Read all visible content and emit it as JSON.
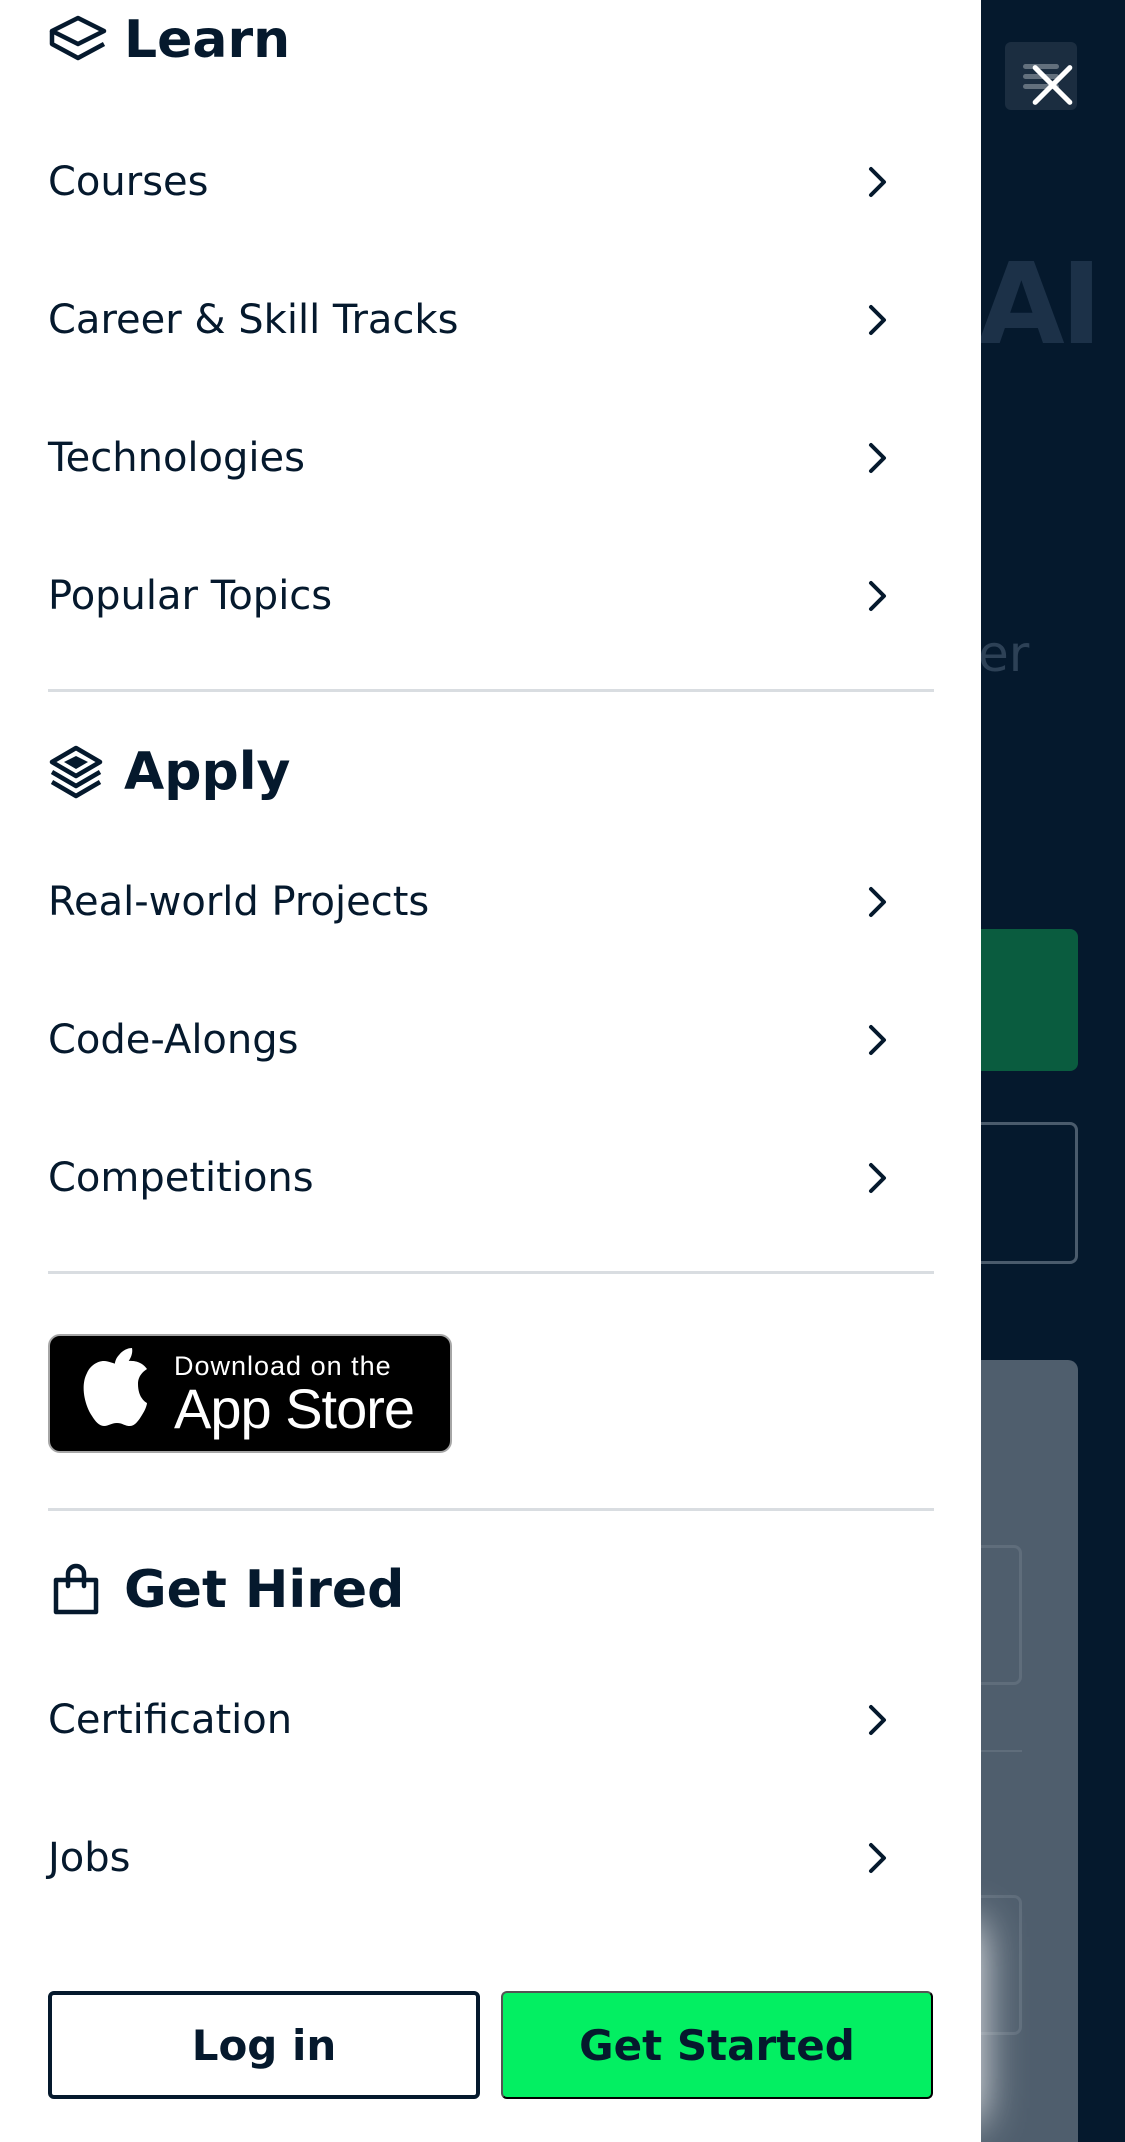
{
  "background": {
    "headline_fragment": "AI",
    "subtext_fragment": "er"
  },
  "sections": {
    "learn": {
      "icon": "layers-icon",
      "title": "Learn",
      "items": [
        {
          "label": "Courses"
        },
        {
          "label": "Career & Skill Tracks"
        },
        {
          "label": "Technologies"
        },
        {
          "label": "Popular Topics"
        }
      ]
    },
    "apply": {
      "icon": "stacked-layers-icon",
      "title": "Apply",
      "items": [
        {
          "label": "Real-world Projects"
        },
        {
          "label": "Code-Alongs"
        },
        {
          "label": "Competitions"
        }
      ]
    },
    "get_hired": {
      "icon": "shopping-bag-icon",
      "title": "Get Hired",
      "items": [
        {
          "label": "Certification"
        },
        {
          "label": "Jobs"
        }
      ]
    }
  },
  "app_store": {
    "line1": "Download on the",
    "line2": "App Store"
  },
  "footer": {
    "login_label": "Log in",
    "get_started_label": "Get Started"
  },
  "colors": {
    "navy": "#05192d",
    "brand_green": "#03ef62",
    "divider": "#d9dde1"
  }
}
